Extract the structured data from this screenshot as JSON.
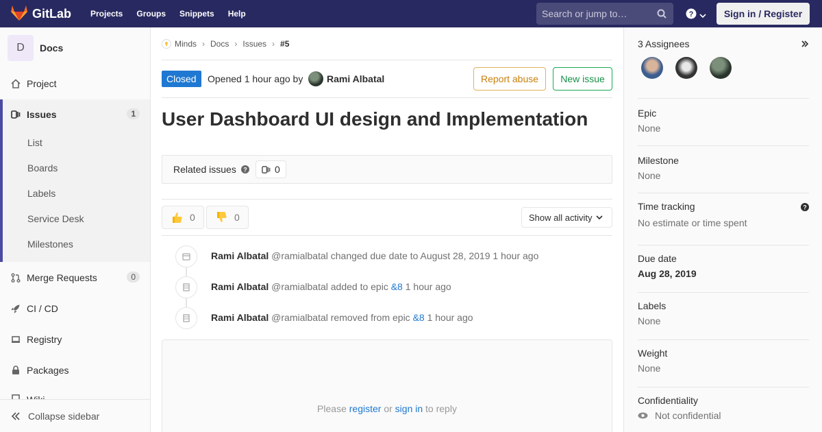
{
  "navbar": {
    "brand": "GitLab",
    "links": [
      "Projects",
      "Groups",
      "Snippets",
      "Help"
    ],
    "search_placeholder": "Search or jump to…",
    "signin_label": "Sign in / Register"
  },
  "sidebar": {
    "project_initial": "D",
    "project_name": "Docs",
    "project_label": "Project",
    "issues_label": "Issues",
    "issues_count": "1",
    "issues_subitems": [
      "List",
      "Boards",
      "Labels",
      "Service Desk",
      "Milestones"
    ],
    "merge_requests_label": "Merge Requests",
    "merge_requests_count": "0",
    "cicd_label": "CI / CD",
    "registry_label": "Registry",
    "packages_label": "Packages",
    "wiki_label": "Wiki",
    "collapse_label": "Collapse sidebar"
  },
  "breadcrumbs": [
    "Minds",
    "Docs",
    "Issues",
    "#5"
  ],
  "issue": {
    "status": "Closed",
    "opened_text": "Opened 1 hour ago by",
    "author": "Rami Albatal",
    "report_abuse_label": "Report abuse",
    "new_issue_label": "New issue",
    "title": "User Dashboard UI design and Implementation",
    "related_label": "Related issues",
    "related_count": "0",
    "thumbs_up_count": "0",
    "thumbs_down_count": "0",
    "activity_filter": "Show all activity"
  },
  "notes": [
    {
      "author": "Rami Albatal",
      "handle": "@ramialbatal",
      "action": "changed due date to August 28, 2019",
      "link": "",
      "time": "1 hour ago"
    },
    {
      "author": "Rami Albatal",
      "handle": "@ramialbatal",
      "action": "added to epic",
      "link": "&8",
      "time": "1 hour ago"
    },
    {
      "author": "Rami Albatal",
      "handle": "@ramialbatal",
      "action": "removed from epic",
      "link": "&8",
      "time": "1 hour ago"
    }
  ],
  "reply": {
    "prefix": "Please",
    "register_label": "register",
    "or_text": "or",
    "signin_label": "sign in",
    "suffix": "to reply"
  },
  "right_sidebar": {
    "assignees_title": "3 Assignees",
    "epic_title": "Epic",
    "epic_value": "None",
    "milestone_title": "Milestone",
    "milestone_value": "None",
    "time_tracking_title": "Time tracking",
    "time_tracking_value": "No estimate or time spent",
    "due_date_title": "Due date",
    "due_date_value": "Aug 28, 2019",
    "labels_title": "Labels",
    "labels_value": "None",
    "weight_title": "Weight",
    "weight_value": "None",
    "confidentiality_title": "Confidentiality",
    "confidentiality_value": "Not confidential"
  },
  "colors": {
    "navbar": "#292961",
    "accent": "#1f78d1",
    "closed_badge": "#1f78d1",
    "new_issue": "#1aaa55",
    "report_abuse": "#e0b15b",
    "active_nav": "#4b4ba3"
  },
  "icons": [
    "gitlab-logo",
    "search-icon",
    "help-icon",
    "home-icon",
    "issues-icon",
    "merge-request-icon",
    "rocket-icon",
    "registry-icon",
    "package-icon",
    "wiki-icon",
    "collapse-icon",
    "question-icon",
    "thumbs-up-icon",
    "thumbs-down-icon",
    "calendar-icon",
    "epic-icon",
    "expand-icon",
    "eye-icon"
  ]
}
